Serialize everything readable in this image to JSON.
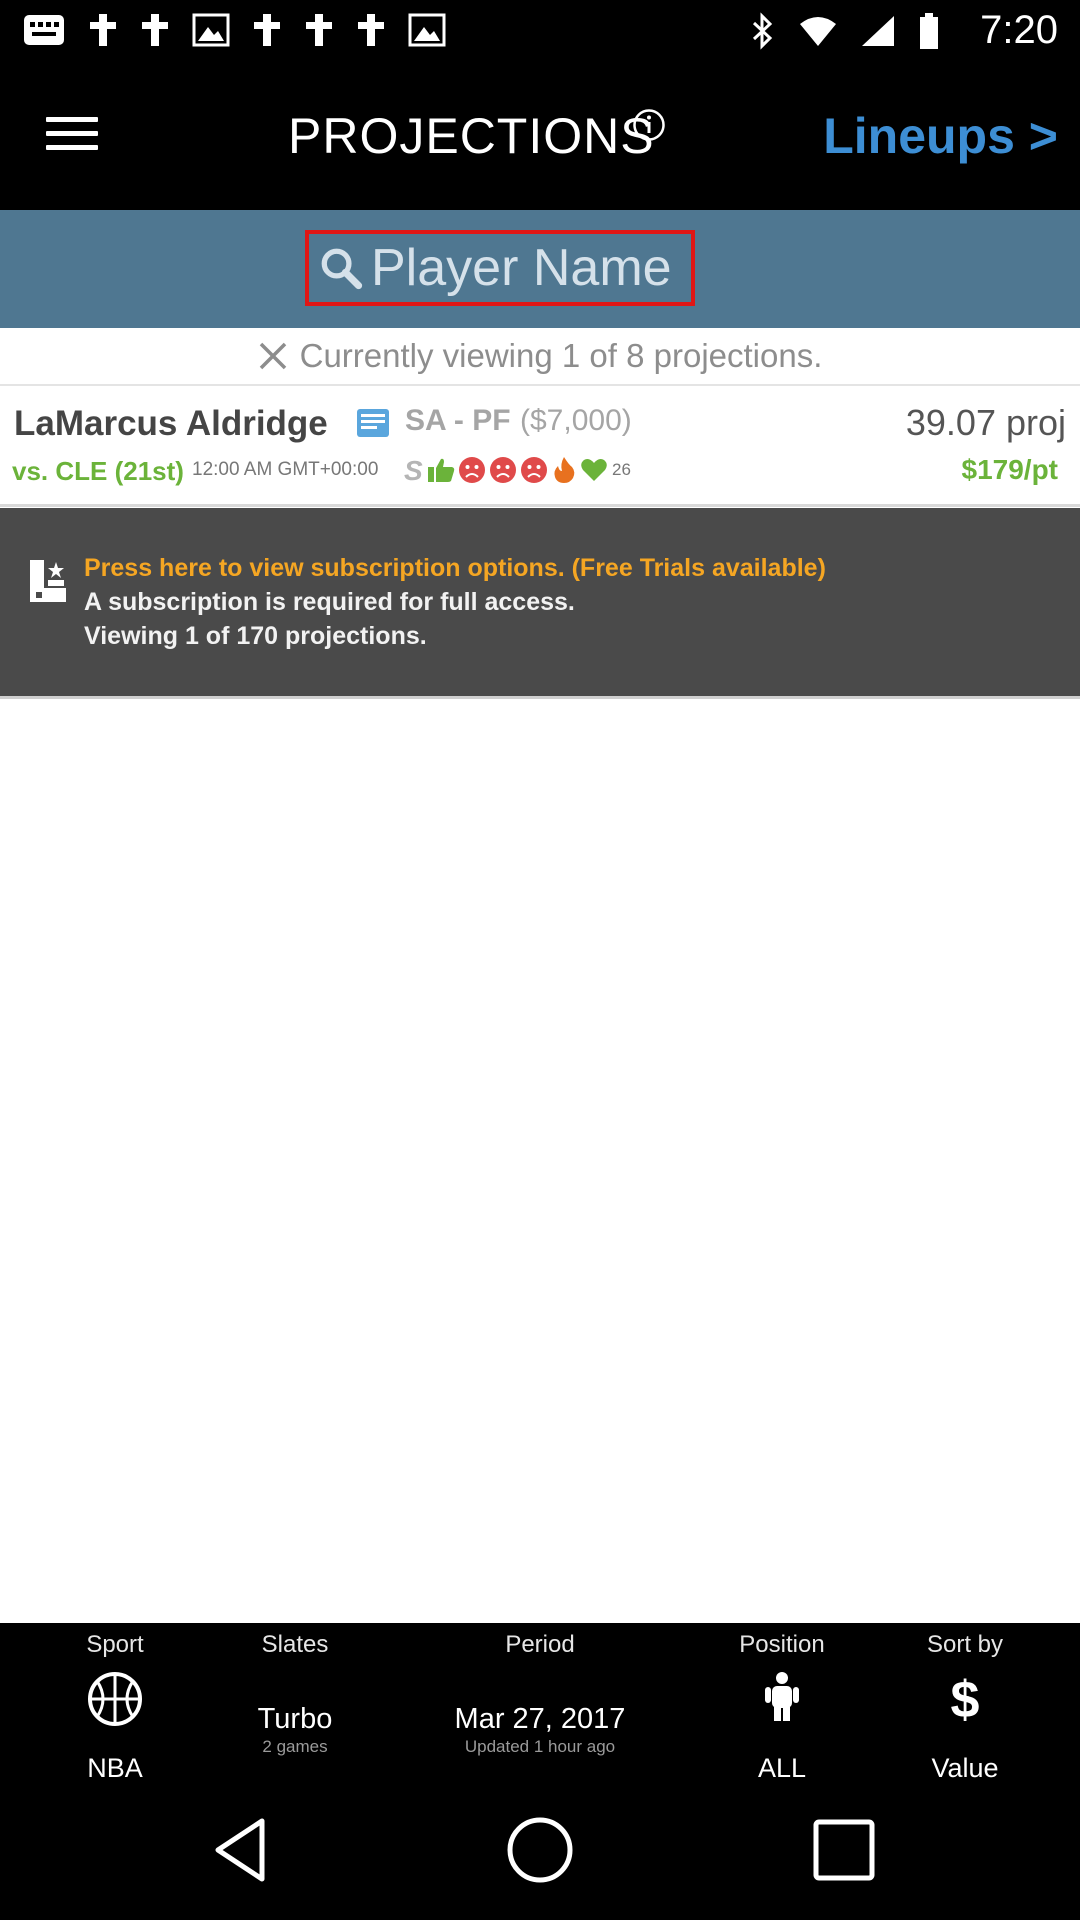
{
  "status_bar": {
    "time": "7:20"
  },
  "header": {
    "title": "PROJECTIONS",
    "lineups_link": "Lineups >"
  },
  "search": {
    "placeholder": "Player Name"
  },
  "viewing": {
    "text": "Currently viewing 1 of 8 projections."
  },
  "player": {
    "name": "LaMarcus Aldridge",
    "position": "SA - PF",
    "salary": "($7,000)",
    "projection": "39.07 proj",
    "opponent": "vs. CLE (21st)",
    "game_time": "12:00 AM GMT+00:00",
    "heart_count": "26",
    "price_per_point": "$179/pt",
    "icons": [
      "s-icon",
      "thumbs-up-icon",
      "sad-face-icon",
      "sad-face-icon",
      "sad-face-icon",
      "fire-icon",
      "heart-icon"
    ]
  },
  "subscription": {
    "line1": "Press here to view subscription options. (Free Trials available)",
    "line2": "A subscription is required for full access.",
    "line3": "Viewing 1 of 170 projections."
  },
  "filters": {
    "sport": {
      "label": "Sport",
      "value": "NBA"
    },
    "slates": {
      "label": "Slates",
      "value": "Turbo",
      "sub": "2 games"
    },
    "period": {
      "label": "Period",
      "value": "Mar 27, 2017",
      "sub": "Updated 1 hour ago"
    },
    "position": {
      "label": "Position",
      "value": "ALL"
    },
    "sort": {
      "label": "Sort by",
      "value": "Value"
    }
  },
  "colors": {
    "accent_blue": "#3d8ed4",
    "search_band": "#4f7791",
    "green": "#6bb33a",
    "orange": "#f5a623",
    "red_outline": "#e01616"
  }
}
